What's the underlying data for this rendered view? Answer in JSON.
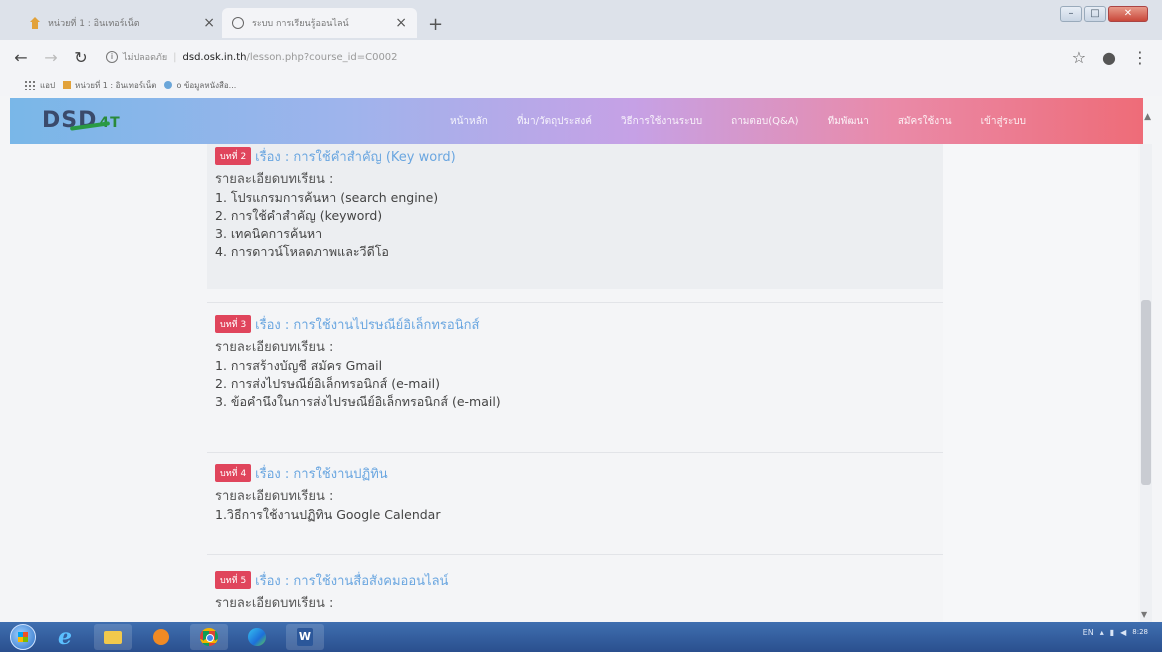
{
  "browser": {
    "tabs": [
      {
        "title": "หน่วยที่ 1 : อินเทอร์เน็ต",
        "active": false
      },
      {
        "title": "ระบบ การเรียนรู้ออนไลน์",
        "active": true
      }
    ],
    "new_tab_label": "+",
    "address": {
      "security_label": "ไม่ปลอดภัย",
      "host": "dsd.osk.in.th",
      "path": "/lesson.php?course_id=C0002"
    },
    "bookmarks": [
      {
        "label": "แอป",
        "icon": "apps-grid-icon"
      },
      {
        "label": "หน่วยที่ 1 : อินเทอร์เน็ต",
        "icon": "house-icon"
      },
      {
        "label": "o ข้อมูลหนังสือ...",
        "icon": "cloud-icon"
      }
    ]
  },
  "site": {
    "logo_text": "DSD",
    "logo_suffix": "4T",
    "menu": [
      "หน้าหลัก",
      "ที่มา/วัตถุประสงค์",
      "วิธีการใช้งานระบบ",
      "ถามตอบ(Q&A)",
      "ทีมพัฒนา",
      "สมัครใช้งาน",
      "เข้าสู่ระบบ"
    ]
  },
  "lessons": [
    {
      "badge": "บทที่ 2",
      "title": "เรื่อง : การใช้คำสำคัญ (Key word)",
      "detail_label": "รายละเอียดบทเรียน :",
      "items": [
        "1. โปรแกรมการค้นหา (search engine)",
        "2. การใช้คำสำคัญ (keyword)",
        "3. เทคนิคการค้นหา",
        "4. การดาวน์โหลดภาพและวีดีโอ"
      ]
    },
    {
      "badge": "บทที่ 3",
      "title": "เรื่อง : การใช้งานไปรษณีย์อิเล็กทรอนิกส์",
      "detail_label": "รายละเอียดบทเรียน :",
      "items": [
        "1. การสร้างบัญชี สมัคร Gmail",
        "2. การส่งไปรษณีย์อิเล็กทรอนิกส์ (e-mail)",
        "3. ข้อคำนึงในการส่งไปรษณีย์อิเล็กทรอนิกส์ (e-mail)"
      ]
    },
    {
      "badge": "บทที่ 4",
      "title": "เรื่อง : การใช้งานปฏิทิน",
      "detail_label": "รายละเอียดบทเรียน :",
      "items": [
        "1.วิธีการใช้งานปฏิทิน Google Calendar"
      ]
    },
    {
      "badge": "บทที่ 5",
      "title": "เรื่อง : การใช้งานสื่อสังคมออนไลน์",
      "detail_label": "รายละเอียดบทเรียน :",
      "items": []
    }
  ],
  "taskbar": {
    "word_letter": "W",
    "tray_language": "EN",
    "clock_time": "8:28"
  },
  "colors": {
    "badge": "#e0455c",
    "title_link": "#6aa6e0",
    "nav_gradient_start": "#79b7e8",
    "nav_gradient_end": "#ee6c78"
  }
}
